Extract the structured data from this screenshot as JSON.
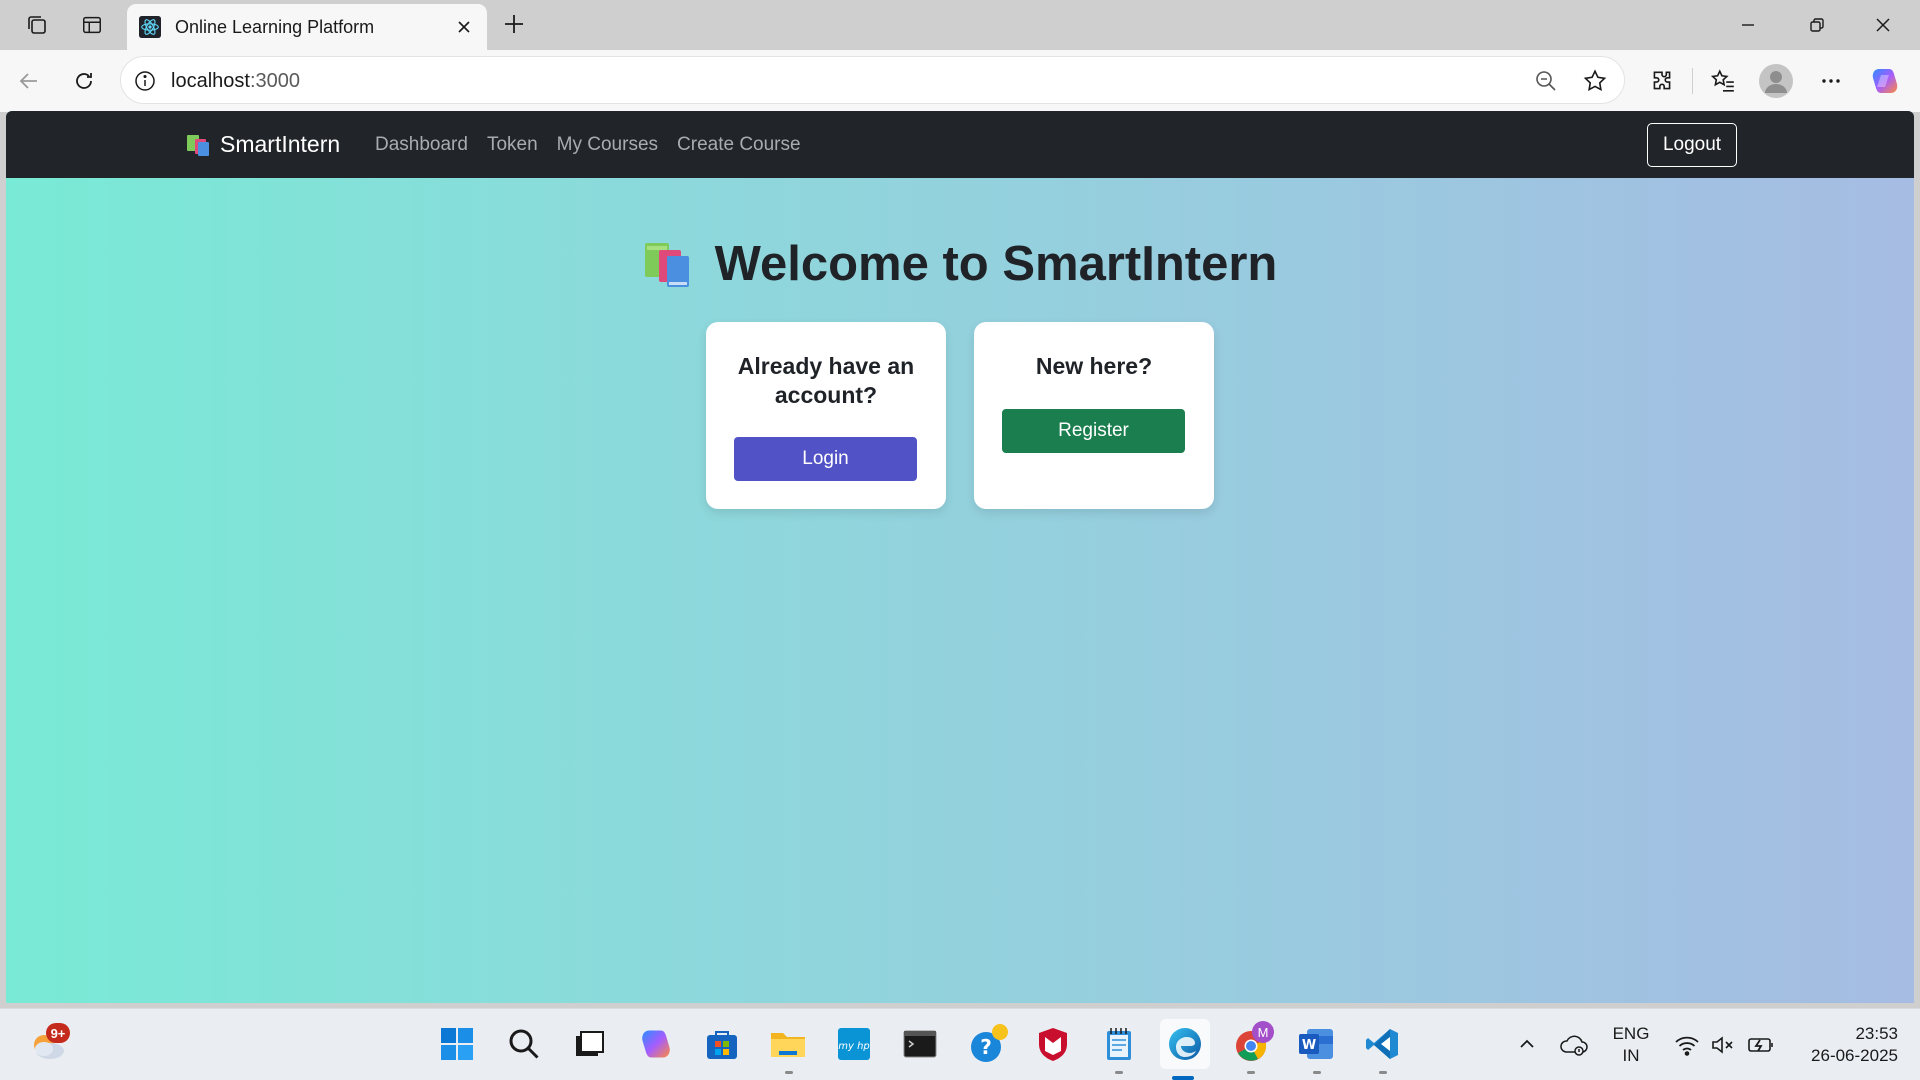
{
  "browser": {
    "tab_title": "Online Learning Platform",
    "url_host": "localhost",
    "url_port": ":3000"
  },
  "navbar": {
    "brand": "SmartIntern",
    "links": [
      "Dashboard",
      "Token",
      "My Courses",
      "Create Course"
    ],
    "logout_label": "Logout"
  },
  "hero": {
    "title": "Welcome to SmartIntern"
  },
  "cards": {
    "login": {
      "heading": "Already have an account?",
      "button": "Login"
    },
    "register": {
      "heading": "New here?",
      "button": "Register"
    }
  },
  "taskbar": {
    "weather_badge": "9+",
    "chrome_badge": "M",
    "lang_line1": "ENG",
    "lang_line2": "IN",
    "time": "23:53",
    "date": "26-06-2025"
  },
  "colors": {
    "navbar_bg": "#212529",
    "login_button": "#5252c7",
    "register_button": "#1a7e4e",
    "gradient_start": "#79ead6",
    "gradient_end": "#a6bce3"
  }
}
